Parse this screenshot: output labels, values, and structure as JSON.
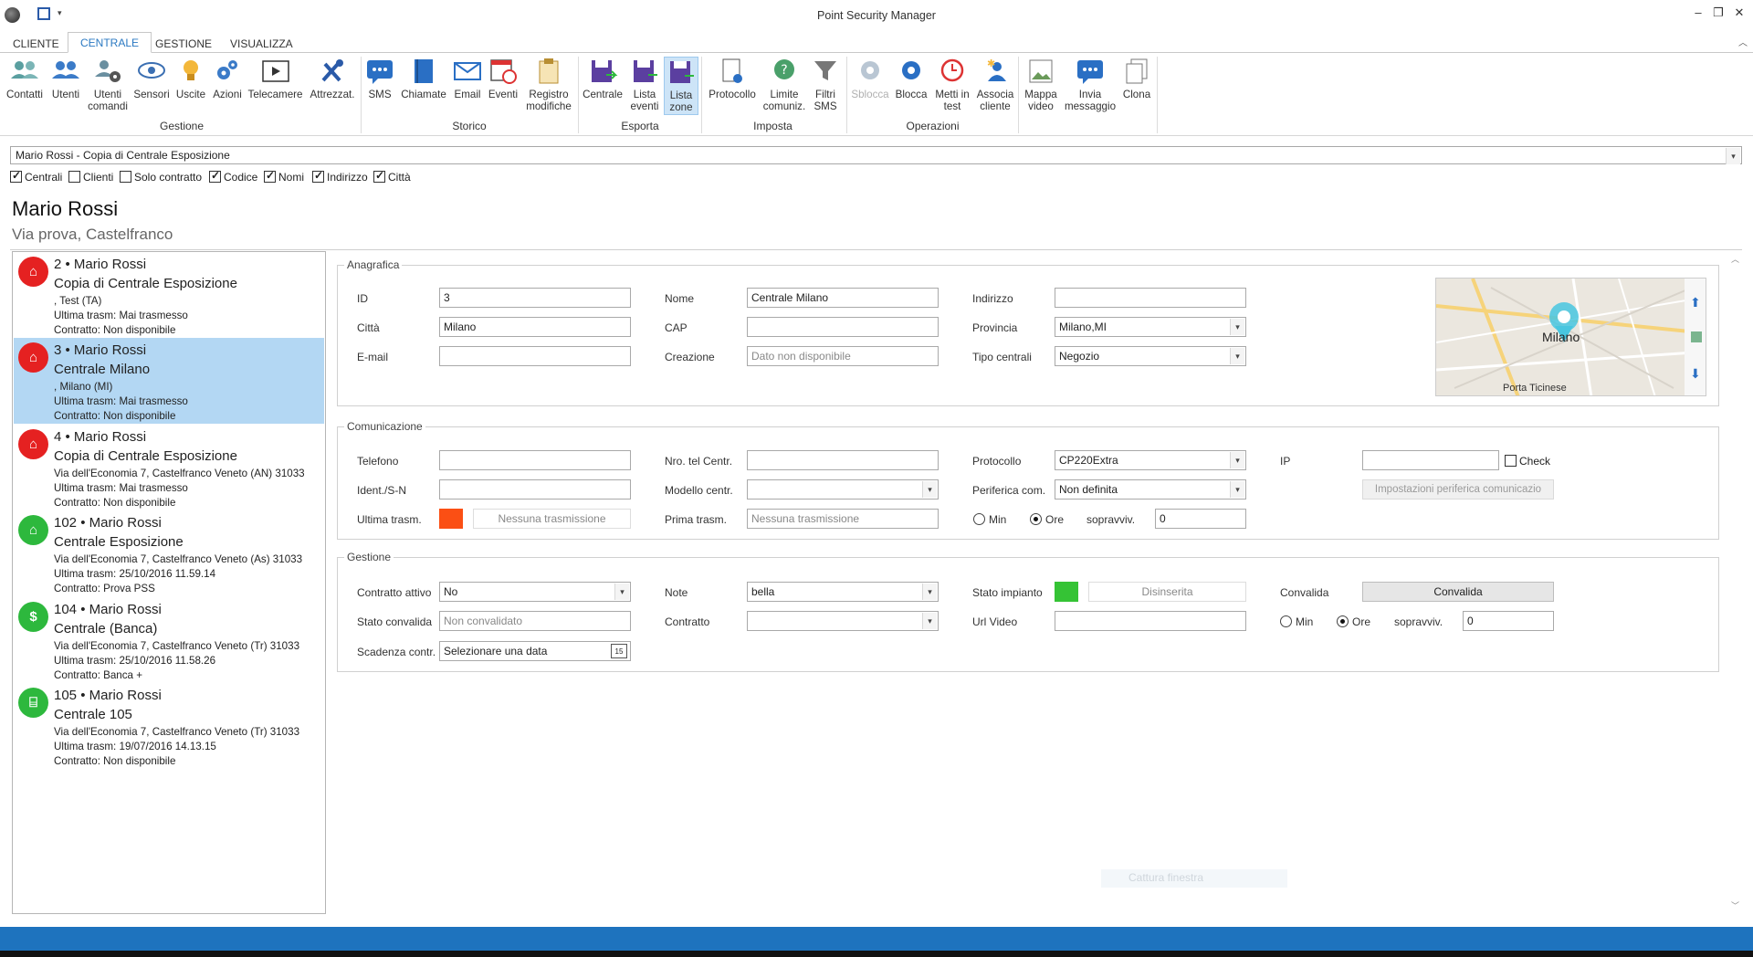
{
  "app": {
    "title": "Point Security Manager",
    "window_controls": [
      "–",
      "❐",
      "✕"
    ]
  },
  "tabs": [
    {
      "label": "CLIENTE",
      "active": false
    },
    {
      "label": "CENTRALE",
      "active": true
    },
    {
      "label": "GESTIONE",
      "active": false
    },
    {
      "label": "VISUALIZZA",
      "active": false
    }
  ],
  "ribbon": {
    "groups": {
      "gestione": "Gestione",
      "storico": "Storico",
      "esporta": "Esporta",
      "imposta": "Imposta",
      "operazioni": "Operazioni"
    },
    "buttons": {
      "contatti": "Contatti",
      "utenti": "Utenti",
      "utenti_comandi_1": "Utenti",
      "utenti_comandi_2": "comandi",
      "sensori": "Sensori",
      "uscite": "Uscite",
      "azioni": "Azioni",
      "telecamere": "Telecamere",
      "attrezzat": "Attrezzat.",
      "sms": "SMS",
      "chiamate": "Chiamate",
      "email": "Email",
      "eventi": "Eventi",
      "registro_1": "Registro",
      "registro_2": "modifiche",
      "centrale": "Centrale",
      "lista_eventi_1": "Lista",
      "lista_eventi_2": "eventi",
      "lista_zone_1": "Lista",
      "lista_zone_2": "zone",
      "protocollo": "Protocollo",
      "limite_1": "Limite",
      "limite_2": "comuniz.",
      "filtri_1": "Filtri",
      "filtri_2": "SMS",
      "sblocca": "Sblocca",
      "blocca": "Blocca",
      "metti_1": "Metti in",
      "metti_2": "test",
      "associa_1": "Associa",
      "associa_2": "cliente",
      "mappa_1": "Mappa",
      "mappa_2": "video",
      "invia_1": "Invia",
      "invia_2": "messaggio",
      "clona": "Clona"
    }
  },
  "search": {
    "value": "Mario Rossi - Copia di Centrale Esposizione"
  },
  "filters": [
    {
      "label": "Centrali",
      "checked": true
    },
    {
      "label": "Clienti",
      "checked": false
    },
    {
      "label": "Solo contratto",
      "checked": false
    },
    {
      "label": "Codice",
      "checked": true
    },
    {
      "label": "Nomi",
      "checked": true
    },
    {
      "label": "Indirizzo",
      "checked": true
    },
    {
      "label": "Città",
      "checked": true
    }
  ],
  "customer": {
    "name": "Mario Rossi",
    "address": "Via prova, Castelfranco"
  },
  "centrali": [
    {
      "title": "2 • Mario Rossi",
      "name": "Copia di Centrale Esposizione",
      "address": ", Test (TA)",
      "last": "Ultima trasm: Mai trasmesso",
      "contract": "Contratto: Non disponibile",
      "color": "#e52121",
      "icon": "shop-icon"
    },
    {
      "title": "3 • Mario Rossi",
      "name": "Centrale Milano",
      "address": ", Milano (MI)",
      "last": "Ultima trasm: Mai trasmesso",
      "contract": "Contratto: Non disponibile",
      "color": "#e52121",
      "icon": "shop-icon"
    },
    {
      "title": "4 • Mario Rossi",
      "name": "Copia di Centrale Esposizione",
      "address": "Via dell'Economia 7, Castelfranco Veneto (AN) 31033",
      "last": "Ultima trasm: Mai trasmesso",
      "contract": "Contratto: Non disponibile",
      "color": "#e52121",
      "icon": "shop-icon"
    },
    {
      "title": "102 • Mario Rossi",
      "name": "Centrale Esposizione",
      "address": "Via dell'Economia 7, Castelfranco Veneto (As) 31033",
      "last": "Ultima trasm: 25/10/2016 11.59.14",
      "contract": "Contratto: Prova PSS",
      "color": "#2db83d",
      "icon": "shop-icon"
    },
    {
      "title": "104 • Mario Rossi",
      "name": "Centrale (Banca)",
      "address": "Via dell'Economia 7, Castelfranco Veneto (Tr) 31033",
      "last": "Ultima trasm: 25/10/2016 11.58.26",
      "contract": "Contratto: Banca +",
      "color": "#2db83d",
      "icon": "money-bag-icon"
    },
    {
      "title": "105 • Mario Rossi",
      "name": "Centrale 105",
      "address": "Via dell'Economia 7, Castelfranco Veneto (Tr) 31033",
      "last": "Ultima trasm: 19/07/2016 14.13.15",
      "contract": "Contratto: Non disponibile",
      "color": "#2db83d",
      "icon": "bank-icon"
    }
  ],
  "anagrafica": {
    "title": "Anagrafica",
    "id_label": "ID",
    "id_value": "3",
    "nome_label": "Nome",
    "nome_value": "Centrale Milano",
    "indirizzo_label": "Indirizzo",
    "indirizzo_value": "",
    "citta_label": "Città",
    "citta_value": "Milano",
    "cap_label": "CAP",
    "cap_value": "",
    "provincia_label": "Provincia",
    "provincia_value": "Milano,MI",
    "email_label": "E-mail",
    "email_value": "",
    "creazione_label": "Creazione",
    "creazione_value": "Dato non disponibile",
    "tipo_label": "Tipo centrali",
    "tipo_value": "Negozio",
    "map_city": "Milano",
    "map_area": "Porta Ticinese"
  },
  "comunicazione": {
    "title": "Comunicazione",
    "telefono_label": "Telefono",
    "nro_label": "Nro. tel Centr.",
    "protocollo_label": "Protocollo",
    "protocollo_value": "CP220Extra",
    "ip_label": "IP",
    "check_label": "Check",
    "ident_label": "Ident./S-N",
    "modello_label": "Modello centr.",
    "periferica_label": "Periferica com.",
    "periferica_value": "Non definita",
    "impostazioni_button": "Impostazioni periferica comunicazio",
    "ultima_label": "Ultima trasm.",
    "ultima_value": "Nessuna trasmissione",
    "prima_label": "Prima trasm.",
    "prima_value": "Nessuna trasmissione",
    "min_label": "Min",
    "ore_label": "Ore",
    "soprav_label": "sopravviv.",
    "soprav_value": "0",
    "status_color": "#fb4f14"
  },
  "gestione": {
    "title": "Gestione",
    "contratto_attivo_label": "Contratto attivo",
    "contratto_attivo_value": "No",
    "note_label": "Note",
    "note_value": "bella",
    "stato_impianto_label": "Stato impianto",
    "stato_impianto_value": "Disinserita",
    "convalida_label": "Convalida",
    "convalida_button": "Convalida",
    "stato_convalida_label": "Stato convalida",
    "stato_convalida_value": "Non convalidato",
    "contratto_label": "Contratto",
    "url_label": "Url Video",
    "min_label": "Min",
    "ore_label": "Ore",
    "soprav_label": "sopravviv.",
    "soprav_value": "0",
    "scadenza_label": "Scadenza contr.",
    "scadenza_value": "Selezionare una data",
    "impianto_color": "#35c335"
  },
  "watermark": "Cattura finestra"
}
